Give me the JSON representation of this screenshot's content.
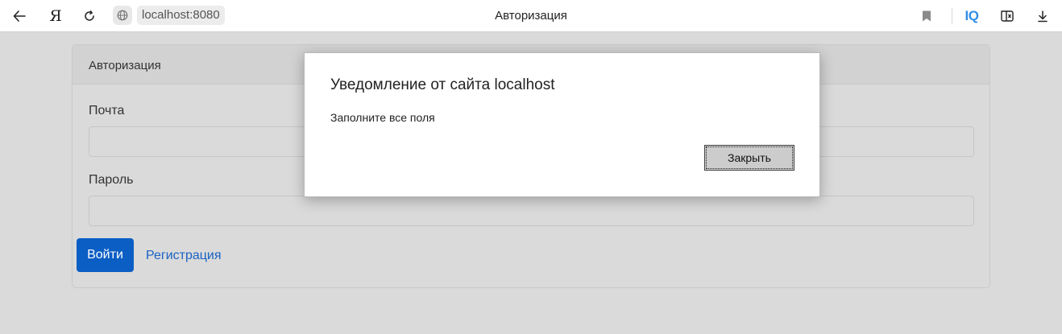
{
  "browser": {
    "url": "localhost:8080",
    "tab_title": "Авторизация",
    "extension_label": "IQ",
    "icons": [
      "back-arrow-icon",
      "yandex-logo-icon",
      "reload-icon",
      "globe-icon",
      "bookmark-icon",
      "iq-extension-icon",
      "reader-mode-icon",
      "download-icon"
    ]
  },
  "card": {
    "header": "Авторизация",
    "email_label": "Почта",
    "email_value": "",
    "password_label": "Пароль",
    "password_value": "",
    "login_button": "Войти",
    "register_link": "Регистрация"
  },
  "dialog": {
    "title": "Уведомление от сайта localhost",
    "message": "Заполните все поля",
    "close_button": "Закрыть"
  },
  "colors": {
    "primary": "#0b5ec4",
    "link": "#1a62c4",
    "overlay_background": "#dadada",
    "iq_accent": "#2f8ee6"
  }
}
